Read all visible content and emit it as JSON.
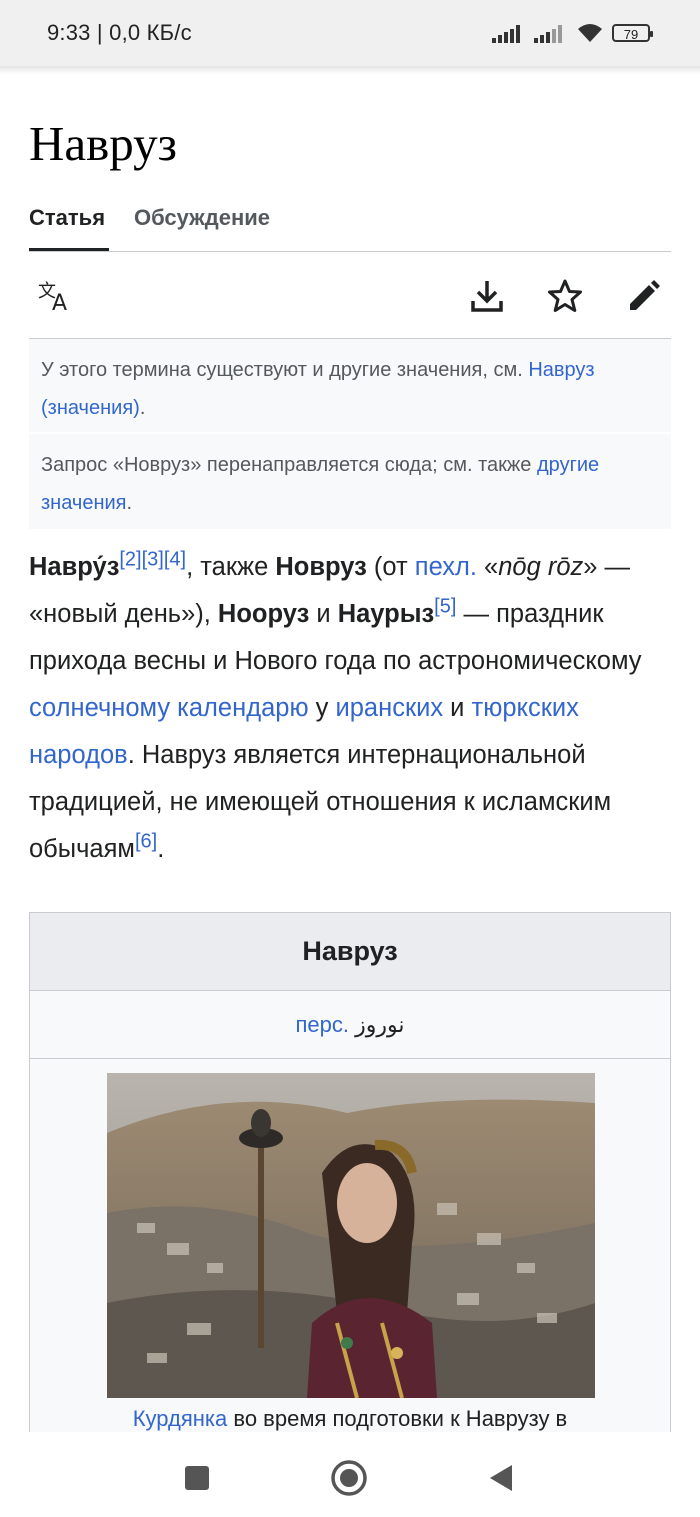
{
  "status": {
    "time": "9:33 | 0,0 КБ/с",
    "battery": "79"
  },
  "page": {
    "title": "Навруз",
    "tabs": [
      "Статья",
      "Обсуждение"
    ]
  },
  "toolbar": {
    "icons": [
      "translate-icon",
      "download-icon",
      "star-icon",
      "edit-icon"
    ]
  },
  "hatnotes": [
    {
      "text": "У этого термина существуют и другие значения, см. ",
      "link": "Навруз (значения)",
      "after": "."
    },
    {
      "text": "Запрос «Новруз» перенаправляется сюда; см. также ",
      "link": "другие значения",
      "after": "."
    }
  ],
  "lead": {
    "t1": "Навру́з",
    "ref1": "[2]",
    "ref2": "[3]",
    "ref3": "[4]",
    "t2": ", также ",
    "t3": "Новруз",
    "t4": " (от ",
    "link1": "пехл.",
    "t5": " «",
    "t6": "nōg rōz",
    "t7": "» — «новый день»), ",
    "t8": "Нооруз",
    "t9": " и ",
    "t10": "Наурыз",
    "ref4": "[5]",
    "t11": " — праздник прихода весны и Нового года по астрономическому ",
    "link2": "солнечному календарю",
    "t12": " у ",
    "link3": "иранских",
    "t13": " и ",
    "link4": "тюркских народов",
    "t14": ". Навруз является интернациональной традицией, не имеющей отношения к исламским обычаям",
    "ref5": "[6]",
    "t15": "."
  },
  "infobox": {
    "title": "Навруз",
    "lang_link": "перс.",
    "lang_text": "نوروز",
    "caption_link": "Курдянка",
    "caption_text": " во время подготовки к Наврузу в"
  },
  "nav": {
    "icons": [
      "square-icon",
      "circle-icon",
      "triangle-back-icon"
    ]
  }
}
